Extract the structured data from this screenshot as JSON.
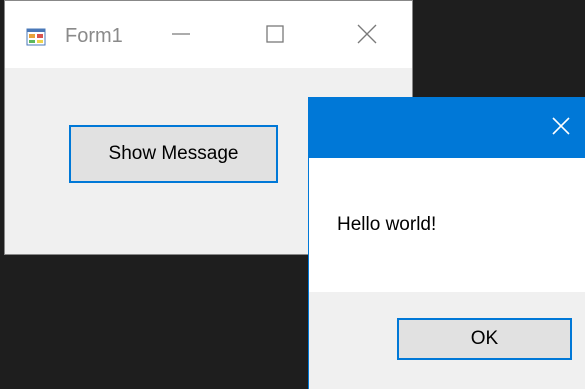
{
  "form": {
    "title": "Form1",
    "show_message_label": "Show Message"
  },
  "message_box": {
    "text": "Hello world!",
    "ok_label": "OK"
  },
  "icons": {
    "app": "form-app-icon",
    "minimize": "minimize-icon",
    "maximize": "maximize-icon",
    "close": "close-icon"
  },
  "colors": {
    "accent": "#0078d7",
    "desktop": "#1e1e1e",
    "window_bg": "#f0f0f0",
    "button_bg": "#e1e1e1"
  }
}
